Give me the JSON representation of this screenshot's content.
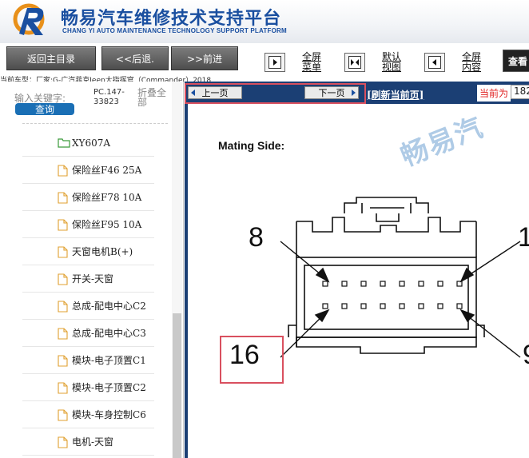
{
  "header": {
    "title": "畅易汽车维修技术支持平台",
    "subtitle": "CHANG YI AUTO MAINTENANCE TECHNOLOGY SUPPORT PLATFORM",
    "logo_letter": "R"
  },
  "toolbar": {
    "back_main": "返回主目录",
    "back": "<<后退.",
    "forward": ">>前进",
    "fullscreen_menu": [
      "全屏",
      "菜单"
    ],
    "default_view": [
      "默认",
      "视图"
    ],
    "fullscreen_content": [
      "全屏",
      "内容"
    ],
    "search": "查看"
  },
  "car_model": "当前车型：厂家:G-广汽菲克Jeep大指挥官（Commander）2018",
  "sidebar": {
    "search_label": "输入关键字:",
    "search_value": [
      "PC.147-",
      "33823"
    ],
    "collapse": [
      "折叠全",
      "部"
    ],
    "query_button": "查询",
    "items": [
      {
        "label": "XY607A",
        "type": "folder"
      },
      {
        "label": "保险丝F46 25A",
        "type": "file"
      },
      {
        "label": "保险丝F78 10A",
        "type": "file"
      },
      {
        "label": "保险丝F95 10A",
        "type": "file"
      },
      {
        "label": "天窗电机B(+)",
        "type": "file"
      },
      {
        "label": "开关-天窗",
        "type": "file"
      },
      {
        "label": "总成-配电中心C2",
        "type": "file"
      },
      {
        "label": "总成-配电中心C3",
        "type": "file"
      },
      {
        "label": "模块-电子顶置C1",
        "type": "file"
      },
      {
        "label": "模块-电子顶置C2",
        "type": "file"
      },
      {
        "label": "模块-车身控制C6",
        "type": "file"
      },
      {
        "label": "电机-天窗",
        "type": "file"
      }
    ]
  },
  "content": {
    "prev_page": "上一页",
    "next_page": "下一页",
    "refresh": "[刷新当前页]",
    "current_label": "当前为",
    "current_value": "182",
    "mating_side": "Mating Side:",
    "watermark": "畅易汽",
    "pin_top_left": "8",
    "pin_bottom_left": "16",
    "pin_bottom_right": "9"
  },
  "colors": {
    "brand_blue": "#1a4fa0",
    "nav_bar": "#1b3f74",
    "highlight_red": "#d9505f",
    "query_blue": "#1a6fb5"
  }
}
